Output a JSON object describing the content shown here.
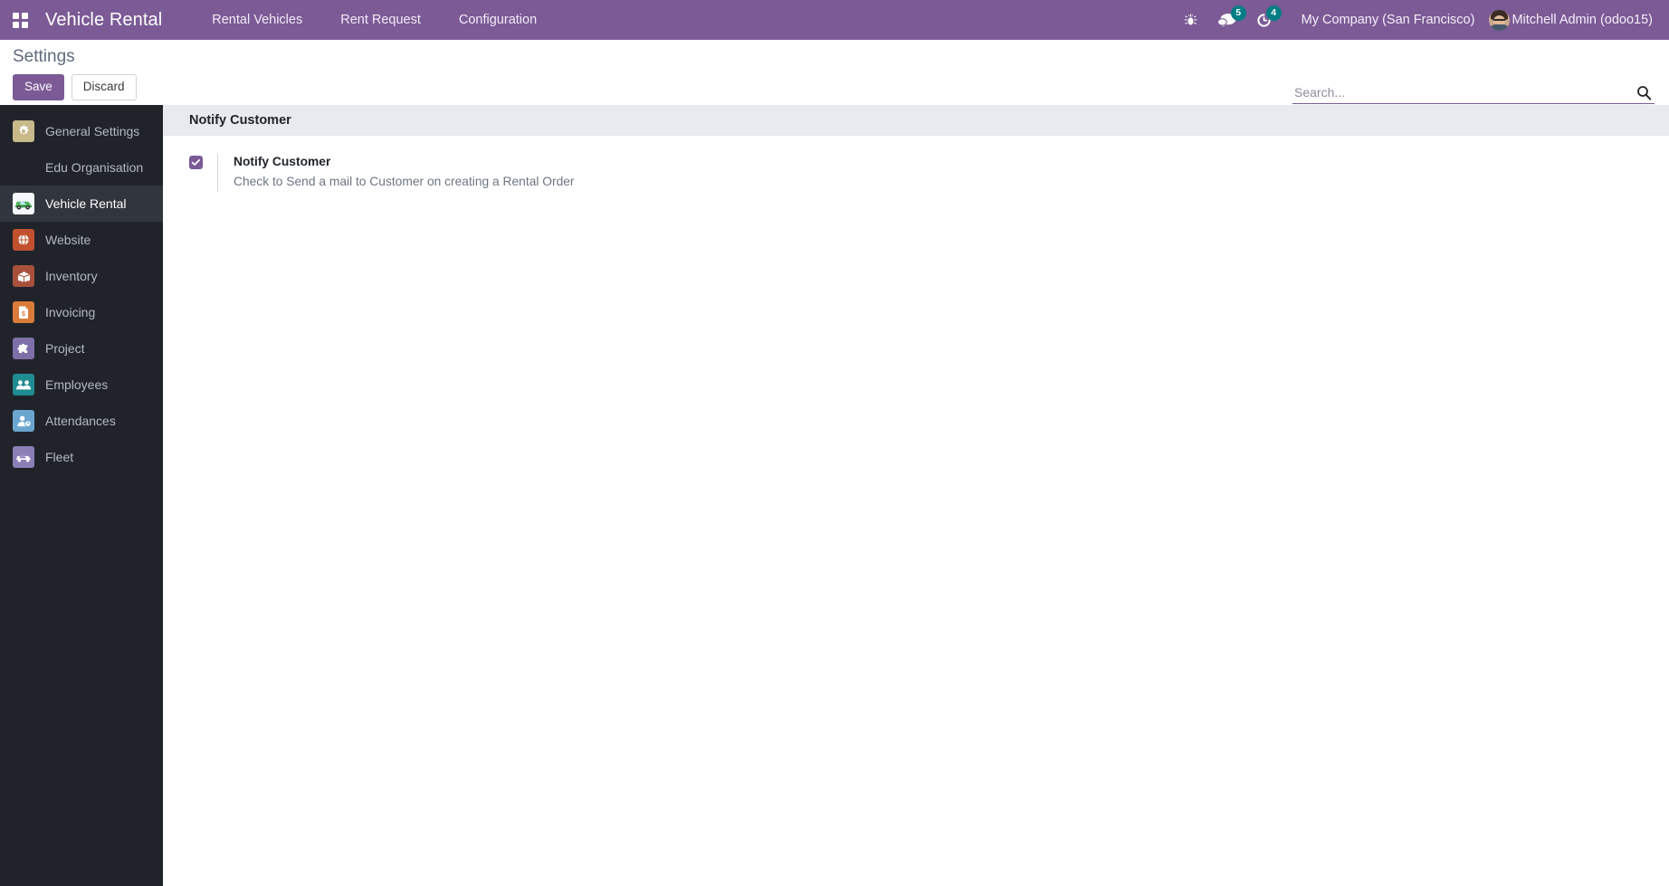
{
  "navbar": {
    "apps_menu_label": "Apps",
    "brand": "Vehicle Rental",
    "menu_items": [
      {
        "label": "Rental Vehicles"
      },
      {
        "label": "Rent Request"
      },
      {
        "label": "Configuration"
      }
    ],
    "icons": [
      {
        "name": "bug-icon",
        "badge": ""
      },
      {
        "name": "messages-icon",
        "badge": "5"
      },
      {
        "name": "activities-icon",
        "badge": "4"
      }
    ],
    "company": "My Company (San Francisco)",
    "user": "Mitchell Admin (odoo15)",
    "brand_color": "#7b5a96",
    "badge_color": "#017e84"
  },
  "control_panel": {
    "title": "Settings",
    "save_label": "Save",
    "discard_label": "Discard",
    "search_placeholder": "Search...",
    "search_value": "",
    "search_icon": "magnifier-icon"
  },
  "sidebar": {
    "items": [
      {
        "label": "General Settings",
        "icon": "gear-app-icon",
        "icon_class": "ico-settings",
        "active": false,
        "has_icon": true
      },
      {
        "label": "Edu Organisation",
        "icon": "none",
        "icon_class": "blank",
        "active": false,
        "has_icon": false
      },
      {
        "label": "Vehicle Rental",
        "icon": "car-app-icon",
        "icon_class": "ico-vehicle",
        "active": true,
        "has_icon": true
      },
      {
        "label": "Website",
        "icon": "globe-app-icon",
        "icon_class": "ico-website",
        "active": false,
        "has_icon": true
      },
      {
        "label": "Inventory",
        "icon": "box-app-icon",
        "icon_class": "ico-inventory",
        "active": false,
        "has_icon": true
      },
      {
        "label": "Invoicing",
        "icon": "invoice-app-icon",
        "icon_class": "ico-invoicing",
        "active": false,
        "has_icon": true
      },
      {
        "label": "Project",
        "icon": "puzzle-app-icon",
        "icon_class": "ico-project",
        "active": false,
        "has_icon": true
      },
      {
        "label": "Employees",
        "icon": "people-app-icon",
        "icon_class": "ico-employees",
        "active": false,
        "has_icon": true
      },
      {
        "label": "Attendances",
        "icon": "badge-app-icon",
        "icon_class": "ico-attend",
        "active": false,
        "has_icon": true
      },
      {
        "label": "Fleet",
        "icon": "fleet-car-app-icon",
        "icon_class": "ico-fleet",
        "active": false,
        "has_icon": true
      }
    ]
  },
  "main": {
    "section_title": "Notify Customer",
    "setting": {
      "checked": true,
      "label": "Notify Customer",
      "help": "Check to Send a mail to Customer on creating a Rental Order"
    },
    "band_color": "#e7eaee"
  }
}
